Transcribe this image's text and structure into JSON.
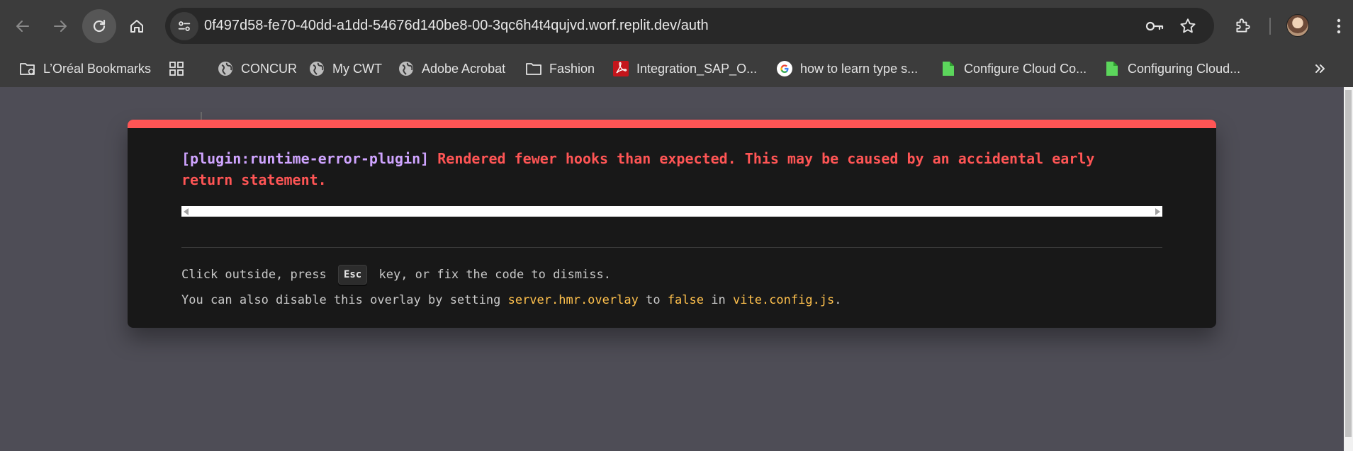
{
  "browser": {
    "url": "0f497d58-fe70-40dd-a1dd-54676d140be8-00-3qc6h4t4qujvd.worf.replit.dev/auth",
    "icons": [
      "back-icon",
      "forward-icon",
      "reload-icon",
      "home-icon",
      "site-settings-icon",
      "key-icon",
      "star-icon",
      "extensions-icon",
      "avatar",
      "kebab-menu-icon"
    ],
    "bookmarks": [
      {
        "label": "L’Oréal Bookmarks",
        "icon": "managed-folder-icon"
      },
      {
        "label": "",
        "icon": "apps-grid-icon"
      },
      {
        "label": "CONCUR",
        "icon": "globe-icon"
      },
      {
        "label": "My CWT",
        "icon": "globe-icon"
      },
      {
        "label": "Adobe Acrobat",
        "icon": "globe-icon"
      },
      {
        "label": "Fashion",
        "icon": "folder-icon"
      },
      {
        "label": "Integration_SAP_O...",
        "icon": "pdf-icon"
      },
      {
        "label": "how to learn type s...",
        "icon": "google-icon"
      },
      {
        "label": "Configure Cloud Co...",
        "icon": "leaf-doc-icon"
      },
      {
        "label": "Configuring Cloud...",
        "icon": "leaf-doc-icon"
      }
    ],
    "overflow_icon": "chevron-double-right-icon"
  },
  "overlay": {
    "plugin": "[plugin:runtime-error-plugin]",
    "message": "Rendered fewer hooks than expected. This may be caused by an accidental early return statement.",
    "tip1": {
      "before": "Click outside, press",
      "key": "Esc",
      "after": "key, or fix the code to dismiss."
    },
    "tip2": {
      "before": "You can also disable this overlay by setting",
      "code1": "server.hmr.overlay",
      "mid1": "to",
      "code2": "false",
      "mid2": "in",
      "code3": "vite.config.js",
      "end": "."
    }
  },
  "colors": {
    "overlay_accent": "#ff5555",
    "plugin_text": "#cfa4ff",
    "code_text": "#ffc14d",
    "page_bg": "#4e4d56",
    "chrome_bg": "#3c3c3c"
  }
}
